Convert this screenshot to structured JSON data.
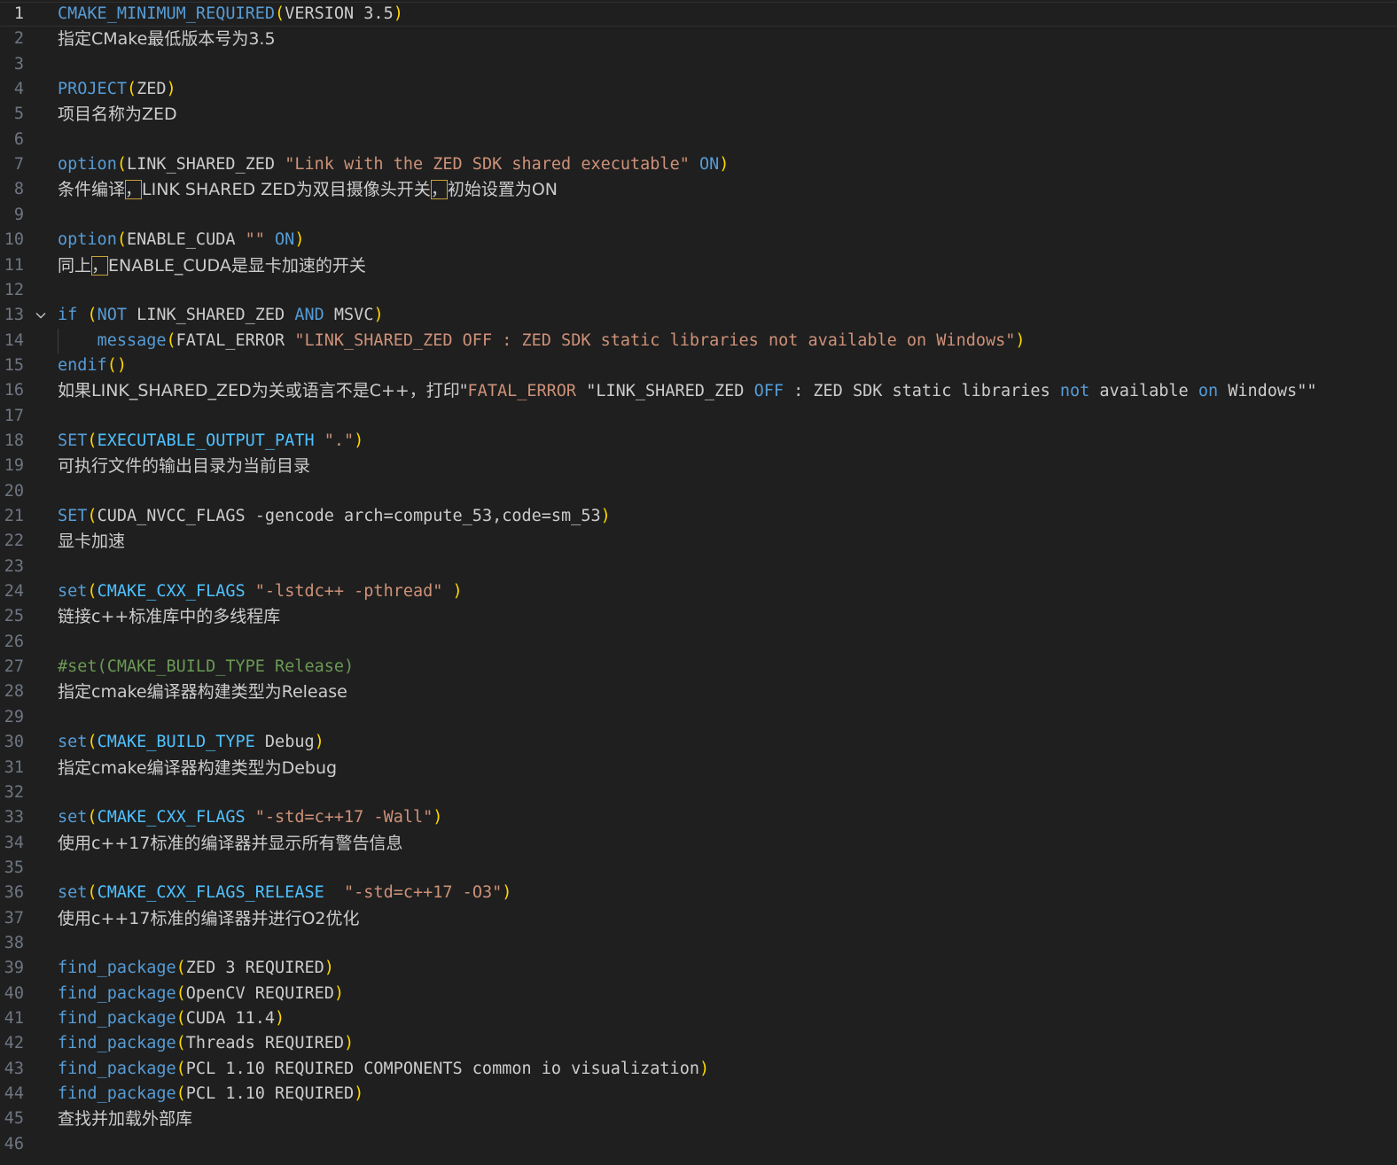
{
  "current_line": 1,
  "lines": [
    {
      "num": "1",
      "kind": "code",
      "tokens": [
        {
          "t": "CMAKE_MINIMUM_REQUIRED",
          "c": "kw"
        },
        {
          "t": "(",
          "c": "pn"
        },
        {
          "t": "VERSION 3.5",
          "c": "tx"
        },
        {
          "t": ")",
          "c": "pn"
        }
      ]
    },
    {
      "num": "2",
      "kind": "zh",
      "tokens": [
        {
          "t": "指定CMake最低版本号为3.5",
          "c": "zh"
        }
      ]
    },
    {
      "num": "3",
      "kind": "empty",
      "tokens": []
    },
    {
      "num": "4",
      "kind": "code",
      "tokens": [
        {
          "t": "PROJECT",
          "c": "kw"
        },
        {
          "t": "(",
          "c": "pn"
        },
        {
          "t": "ZED",
          "c": "tx"
        },
        {
          "t": ")",
          "c": "pn"
        }
      ]
    },
    {
      "num": "5",
      "kind": "zh",
      "tokens": [
        {
          "t": "项目名称为ZED",
          "c": "zh"
        }
      ]
    },
    {
      "num": "6",
      "kind": "empty",
      "tokens": []
    },
    {
      "num": "7",
      "kind": "code",
      "tokens": [
        {
          "t": "option",
          "c": "kw"
        },
        {
          "t": "(",
          "c": "pn"
        },
        {
          "t": "LINK_SHARED_ZED ",
          "c": "tx"
        },
        {
          "t": "\"Link with the ZED SDK shared executable\"",
          "c": "str"
        },
        {
          "t": " ",
          "c": "tx"
        },
        {
          "t": "ON",
          "c": "kw"
        },
        {
          "t": ")",
          "c": "pn"
        }
      ]
    },
    {
      "num": "8",
      "kind": "zh",
      "tokens": [
        {
          "t": "条件编译",
          "c": "zh"
        },
        {
          "t": "，",
          "c": "zh hl"
        },
        {
          "t": "LINK SHARED ZED为双目摄像头开关",
          "c": "zh"
        },
        {
          "t": "，",
          "c": "zh hl"
        },
        {
          "t": "初始设置为ON",
          "c": "zh"
        }
      ]
    },
    {
      "num": "9",
      "kind": "empty",
      "tokens": []
    },
    {
      "num": "10",
      "kind": "code",
      "tokens": [
        {
          "t": "option",
          "c": "kw"
        },
        {
          "t": "(",
          "c": "pn"
        },
        {
          "t": "ENABLE_CUDA ",
          "c": "tx"
        },
        {
          "t": "\"\"",
          "c": "str"
        },
        {
          "t": " ",
          "c": "tx"
        },
        {
          "t": "ON",
          "c": "kw"
        },
        {
          "t": ")",
          "c": "pn"
        }
      ]
    },
    {
      "num": "11",
      "kind": "zh",
      "tokens": [
        {
          "t": "同上",
          "c": "zh"
        },
        {
          "t": "，",
          "c": "zh hl"
        },
        {
          "t": "ENABLE_CUDA是显卡加速的开关",
          "c": "zh"
        }
      ]
    },
    {
      "num": "12",
      "kind": "empty",
      "tokens": []
    },
    {
      "num": "13",
      "kind": "code",
      "fold": true,
      "tokens": [
        {
          "t": "if",
          "c": "kw"
        },
        {
          "t": " ",
          "c": "tx"
        },
        {
          "t": "(",
          "c": "pn"
        },
        {
          "t": "NOT",
          "c": "kw"
        },
        {
          "t": " LINK_SHARED_ZED ",
          "c": "tx"
        },
        {
          "t": "AND",
          "c": "kw"
        },
        {
          "t": " MSVC",
          "c": "tx"
        },
        {
          "t": ")",
          "c": "pn"
        }
      ]
    },
    {
      "num": "14",
      "kind": "code",
      "indent": true,
      "tokens": [
        {
          "t": "    ",
          "c": "tx"
        },
        {
          "t": "message",
          "c": "kw"
        },
        {
          "t": "(",
          "c": "pn"
        },
        {
          "t": "FATAL_ERROR ",
          "c": "tx"
        },
        {
          "t": "\"LINK_SHARED_ZED OFF : ZED SDK static libraries not available on Windows\"",
          "c": "str"
        },
        {
          "t": ")",
          "c": "pn"
        }
      ]
    },
    {
      "num": "15",
      "kind": "code",
      "tokens": [
        {
          "t": "endif",
          "c": "kw"
        },
        {
          "t": "()",
          "c": "pn"
        }
      ]
    },
    {
      "num": "16",
      "kind": "zh",
      "tokens": [
        {
          "t": "如果LINK_SHARED_ZED为关或语言不是C++，打印\"",
          "c": "zh"
        },
        {
          "t": "FATAL_ERROR",
          "c": "str"
        },
        {
          "t": " \"LINK_SHARED_ZED ",
          "c": "tx"
        },
        {
          "t": "OFF",
          "c": "kw"
        },
        {
          "t": " : ZED SDK static libraries ",
          "c": "tx"
        },
        {
          "t": "not",
          "c": "kw"
        },
        {
          "t": " available ",
          "c": "tx"
        },
        {
          "t": "on",
          "c": "kw"
        },
        {
          "t": " Windows\"\"",
          "c": "tx"
        }
      ]
    },
    {
      "num": "17",
      "kind": "empty",
      "tokens": []
    },
    {
      "num": "18",
      "kind": "code",
      "tokens": [
        {
          "t": "SET",
          "c": "kw"
        },
        {
          "t": "(",
          "c": "pn"
        },
        {
          "t": "EXECUTABLE_OUTPUT_PATH",
          "c": "kw2"
        },
        {
          "t": " ",
          "c": "tx"
        },
        {
          "t": "\".\"",
          "c": "str"
        },
        {
          "t": ")",
          "c": "pn"
        }
      ]
    },
    {
      "num": "19",
      "kind": "zh",
      "tokens": [
        {
          "t": "可执行文件的输出目录为当前目录",
          "c": "zh"
        }
      ]
    },
    {
      "num": "20",
      "kind": "empty",
      "tokens": []
    },
    {
      "num": "21",
      "kind": "code",
      "tokens": [
        {
          "t": "SET",
          "c": "kw"
        },
        {
          "t": "(",
          "c": "pn"
        },
        {
          "t": "CUDA_NVCC_FLAGS -gencode arch=compute_53,code=sm_53",
          "c": "tx"
        },
        {
          "t": ")",
          "c": "pn"
        }
      ]
    },
    {
      "num": "22",
      "kind": "zh",
      "tokens": [
        {
          "t": "显卡加速",
          "c": "zh"
        }
      ]
    },
    {
      "num": "23",
      "kind": "empty",
      "tokens": []
    },
    {
      "num": "24",
      "kind": "code",
      "tokens": [
        {
          "t": "set",
          "c": "kw"
        },
        {
          "t": "(",
          "c": "pn"
        },
        {
          "t": "CMAKE_CXX_FLAGS",
          "c": "kw2"
        },
        {
          "t": " ",
          "c": "tx"
        },
        {
          "t": "\"-lstdc++ -pthread\"",
          "c": "str"
        },
        {
          "t": " ",
          "c": "tx"
        },
        {
          "t": ")",
          "c": "pn"
        }
      ]
    },
    {
      "num": "25",
      "kind": "zh",
      "tokens": [
        {
          "t": "链接c++标准库中的多线程库",
          "c": "zh"
        }
      ]
    },
    {
      "num": "26",
      "kind": "empty",
      "tokens": []
    },
    {
      "num": "27",
      "kind": "code",
      "tokens": [
        {
          "t": "#set(CMAKE_BUILD_TYPE Release)",
          "c": "cm"
        }
      ]
    },
    {
      "num": "28",
      "kind": "zh",
      "tokens": [
        {
          "t": "指定cmake编译器构建类型为Release",
          "c": "zh"
        }
      ]
    },
    {
      "num": "29",
      "kind": "empty",
      "tokens": []
    },
    {
      "num": "30",
      "kind": "code",
      "tokens": [
        {
          "t": "set",
          "c": "kw"
        },
        {
          "t": "(",
          "c": "pn"
        },
        {
          "t": "CMAKE_BUILD_TYPE",
          "c": "kw2"
        },
        {
          "t": " Debug",
          "c": "tx"
        },
        {
          "t": ")",
          "c": "pn"
        }
      ]
    },
    {
      "num": "31",
      "kind": "zh",
      "tokens": [
        {
          "t": "指定cmake编译器构建类型为Debug",
          "c": "zh"
        }
      ]
    },
    {
      "num": "32",
      "kind": "empty",
      "tokens": []
    },
    {
      "num": "33",
      "kind": "code",
      "tokens": [
        {
          "t": "set",
          "c": "kw"
        },
        {
          "t": "(",
          "c": "pn"
        },
        {
          "t": "CMAKE_CXX_FLAGS",
          "c": "kw2"
        },
        {
          "t": " ",
          "c": "tx"
        },
        {
          "t": "\"-std=c++17 -Wall\"",
          "c": "str"
        },
        {
          "t": ")",
          "c": "pn"
        }
      ]
    },
    {
      "num": "34",
      "kind": "zh",
      "tokens": [
        {
          "t": "使用c++17标准的编译器并显示所有警告信息",
          "c": "zh"
        }
      ]
    },
    {
      "num": "35",
      "kind": "empty",
      "tokens": []
    },
    {
      "num": "36",
      "kind": "code",
      "tokens": [
        {
          "t": "set",
          "c": "kw"
        },
        {
          "t": "(",
          "c": "pn"
        },
        {
          "t": "CMAKE_CXX_FLAGS_RELEASE",
          "c": "kw2"
        },
        {
          "t": "  ",
          "c": "tx"
        },
        {
          "t": "\"-std=c++17 -O3\"",
          "c": "str"
        },
        {
          "t": ")",
          "c": "pn"
        }
      ]
    },
    {
      "num": "37",
      "kind": "zh",
      "tokens": [
        {
          "t": "使用c++17标准的编译器并进行O2优化",
          "c": "zh"
        }
      ]
    },
    {
      "num": "38",
      "kind": "empty",
      "tokens": []
    },
    {
      "num": "39",
      "kind": "code",
      "tokens": [
        {
          "t": "find_package",
          "c": "kw"
        },
        {
          "t": "(",
          "c": "pn"
        },
        {
          "t": "ZED 3 REQUIRED",
          "c": "tx"
        },
        {
          "t": ")",
          "c": "pn"
        }
      ]
    },
    {
      "num": "40",
      "kind": "code",
      "tokens": [
        {
          "t": "find_package",
          "c": "kw"
        },
        {
          "t": "(",
          "c": "pn"
        },
        {
          "t": "OpenCV REQUIRED",
          "c": "tx"
        },
        {
          "t": ")",
          "c": "pn"
        }
      ]
    },
    {
      "num": "41",
      "kind": "code",
      "tokens": [
        {
          "t": "find_package",
          "c": "kw"
        },
        {
          "t": "(",
          "c": "pn"
        },
        {
          "t": "CUDA 11.4",
          "c": "tx"
        },
        {
          "t": ")",
          "c": "pn"
        }
      ]
    },
    {
      "num": "42",
      "kind": "code",
      "tokens": [
        {
          "t": "find_package",
          "c": "kw"
        },
        {
          "t": "(",
          "c": "pn"
        },
        {
          "t": "Threads REQUIRED",
          "c": "tx"
        },
        {
          "t": ")",
          "c": "pn"
        }
      ]
    },
    {
      "num": "43",
      "kind": "code",
      "tokens": [
        {
          "t": "find_package",
          "c": "kw"
        },
        {
          "t": "(",
          "c": "pn"
        },
        {
          "t": "PCL 1.10 REQUIRED COMPONENTS common io visualization",
          "c": "tx"
        },
        {
          "t": ")",
          "c": "pn"
        }
      ]
    },
    {
      "num": "44",
      "kind": "code",
      "tokens": [
        {
          "t": "find_package",
          "c": "kw"
        },
        {
          "t": "(",
          "c": "pn"
        },
        {
          "t": "PCL 1.10 REQUIRED",
          "c": "tx"
        },
        {
          "t": ")",
          "c": "pn"
        }
      ]
    },
    {
      "num": "45",
      "kind": "zh",
      "tokens": [
        {
          "t": "查找并加载外部库",
          "c": "zh"
        }
      ]
    },
    {
      "num": "46",
      "kind": "empty",
      "tokens": []
    }
  ],
  "colors": {
    "background": "#1f1f1f",
    "keyword": "#569cd6",
    "variable": "#4fc1ff",
    "bracket": "#ffd700",
    "string": "#ce9178",
    "comment": "#6a9955",
    "text": "#cccccc",
    "line_number": "#6e7681"
  },
  "icons": {
    "fold": "chevron-down-icon"
  }
}
